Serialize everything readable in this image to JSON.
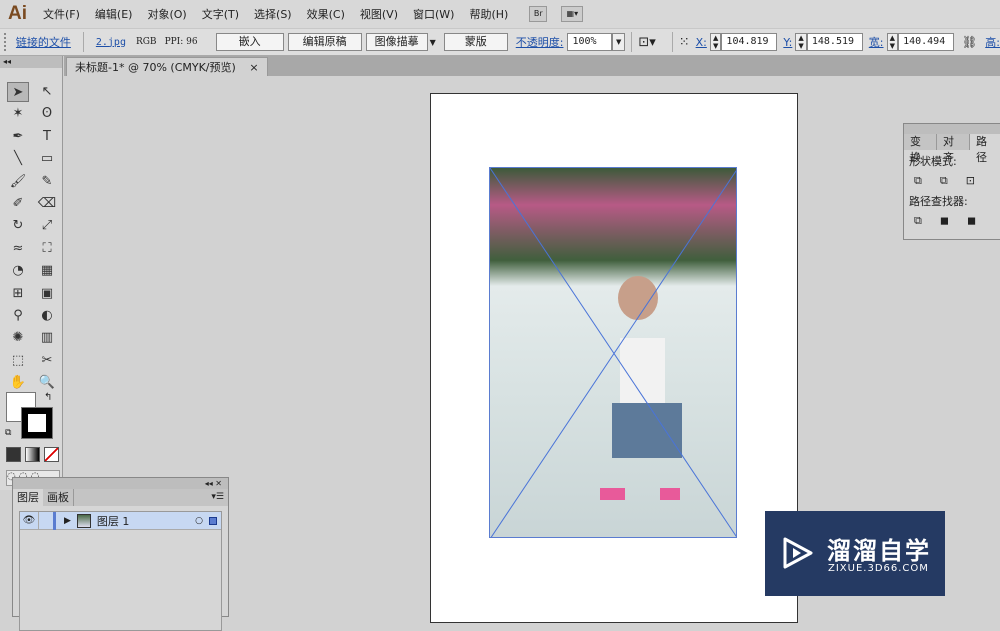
{
  "app": {
    "logo": "Ai",
    "menus": [
      "文件(F)",
      "编辑(E)",
      "对象(O)",
      "文字(T)",
      "选择(S)",
      "效果(C)",
      "视图(V)",
      "窗口(W)",
      "帮助(H)"
    ],
    "bridge": "Br"
  },
  "control": {
    "linked_file": "链接的文件",
    "filename": "2.jpg",
    "color_mode": "RGB",
    "ppi": "PPI: 96",
    "embed": "嵌入",
    "edit_original": "编辑原稿",
    "image_trace": "图像描摹",
    "mask": "蒙版",
    "opacity_label": "不透明度:",
    "opacity": "100%",
    "x_label": "X:",
    "x": "104.819",
    "y_label": "Y:",
    "y": "148.519",
    "w_label": "宽:",
    "w": "140.494",
    "h_label": "高:"
  },
  "document": {
    "tab": "未标题-1* @ 70% (CMYK/预览)",
    "close": "×"
  },
  "tools": [
    "selection-icon",
    "direct-selection-icon",
    "magic-wand-icon",
    "lasso-icon",
    "pen-icon",
    "type-icon",
    "line-icon",
    "rectangle-icon",
    "paintbrush-icon",
    "pencil-icon",
    "blob-brush-icon",
    "eraser-icon",
    "rotate-icon",
    "scale-icon",
    "warp-icon",
    "free-transform-icon",
    "shape-builder-icon",
    "perspective-grid-icon",
    "mesh-icon",
    "gradient-icon",
    "eyedropper-icon",
    "blend-icon",
    "symbol-sprayer-icon",
    "column-graph-icon",
    "artboard-icon",
    "slice-icon",
    "hand-icon",
    "zoom-icon"
  ],
  "tool_glyphs": [
    "➤",
    "↖",
    "✶",
    "ʘ",
    "✒",
    "T",
    "╲",
    "▭",
    "🖌",
    "✎",
    "✐",
    "⌫",
    "↻",
    "⤢",
    "≈",
    "⛶",
    "◔",
    "▦",
    "⊞",
    "▣",
    "⚲",
    "◐",
    "✺",
    "▥",
    "⬚",
    "✂",
    "✋",
    "🔍"
  ],
  "right_panel": {
    "tabs": [
      "变换",
      "对齐",
      "路径"
    ],
    "shape_modes": "形状模式:",
    "pathfinder": "路径查找器:"
  },
  "layers_panel": {
    "tabs": [
      "图层",
      "画板"
    ],
    "layer_name": "图层 1"
  },
  "watermark": {
    "title": "溜溜自学",
    "url": "ZIXUE.3D66.COM"
  }
}
